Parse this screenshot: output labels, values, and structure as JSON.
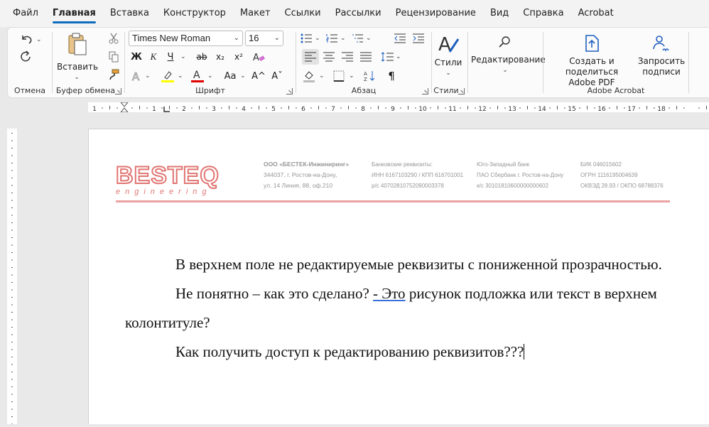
{
  "menu": {
    "tabs": [
      "Файл",
      "Главная",
      "Вставка",
      "Конструктор",
      "Макет",
      "Ссылки",
      "Рассылки",
      "Рецензирование",
      "Вид",
      "Справка",
      "Acrobat"
    ]
  },
  "ribbon": {
    "undo_group": "Отмена",
    "clipboard": {
      "label": "Буфер обмена",
      "paste": "Вставить"
    },
    "font": {
      "label": "Шрифт",
      "name": "Times New Roman",
      "size": "16",
      "bold": "Ж",
      "italic": "К",
      "underline": "Ч",
      "strike": "ab",
      "subscript": "x₂",
      "superscript": "x²",
      "case": "Aa",
      "grow": "A^",
      "shrink": "Aˇ"
    },
    "paragraph": {
      "label": "Абзац"
    },
    "styles": {
      "label": "Стили",
      "button": "Стили"
    },
    "editing": {
      "button": "Редактирование"
    },
    "acrobat": {
      "label": "Adobe Acrobat",
      "create_line1": "Создать и поделиться",
      "create_line2": "Adobe PDF",
      "sign_line1": "Запросить",
      "sign_line2": "подписи"
    },
    "colors": {
      "highlight": "#ffff00",
      "font_color": "#e00000"
    }
  },
  "ruler": {
    "marks": [
      "1",
      "1",
      "2",
      "3",
      "4",
      "5",
      "6",
      "7",
      "8",
      "9",
      "10",
      "11",
      "12",
      "13",
      "14",
      "15",
      "16",
      "17",
      "18"
    ]
  },
  "header": {
    "logo": "BESTEQ",
    "logo_sub": "engineering",
    "col1": [
      "ООО «БЕСТЕК-Инжиниринг»",
      "344037, г. Ростов-на-Дону,",
      "ул. 14 Линия, 88, оф.210"
    ],
    "col2": [
      "Банковские реквизиты:",
      "ИНН 6167103290 / КПП 616701001",
      "р/с 40702810752090003378"
    ],
    "col3": [
      "Юго-Западный банк",
      "ПАО Сбербанк г. Ростов-на-Дону",
      "к/с 30101810600000000602"
    ],
    "col4": [
      "БИК 046015602",
      "ОГРН 1116195004639",
      "ОКВЭД 28.93 / ОКПО 68788376"
    ]
  },
  "body": {
    "p1": "В верхнем поле не редактируемые реквизиты с пониженной прозрачностью.",
    "p2a": "Не понятно – как это сделано? ",
    "p2link": "- Это",
    "p2b": " рисунок подложка или текст в верхнем колонтитуле?",
    "p3": "Как получить доступ к редактированию реквизитов???"
  }
}
